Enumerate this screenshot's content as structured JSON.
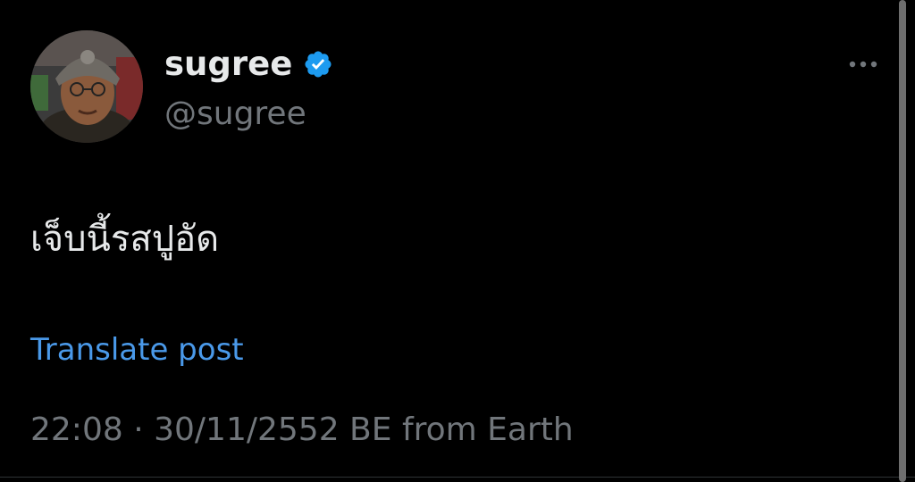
{
  "author": {
    "display_name": "sugree",
    "handle": "@sugree",
    "avatar": "profile-photo",
    "verified_icon": "verified-badge-icon"
  },
  "post": {
    "text": "เจ็บนี้รสปูอัด",
    "translate_label": "Translate post",
    "time": "22:08",
    "separator": "·",
    "date": "30/11/2552 BE",
    "source": "from Earth"
  },
  "more_icon": "more-options-icon",
  "colors": {
    "background": "#000000",
    "text": "#e7e9ea",
    "secondary_text": "#71767b",
    "link": "#4a99e9",
    "verified": "#1d9bf0"
  }
}
